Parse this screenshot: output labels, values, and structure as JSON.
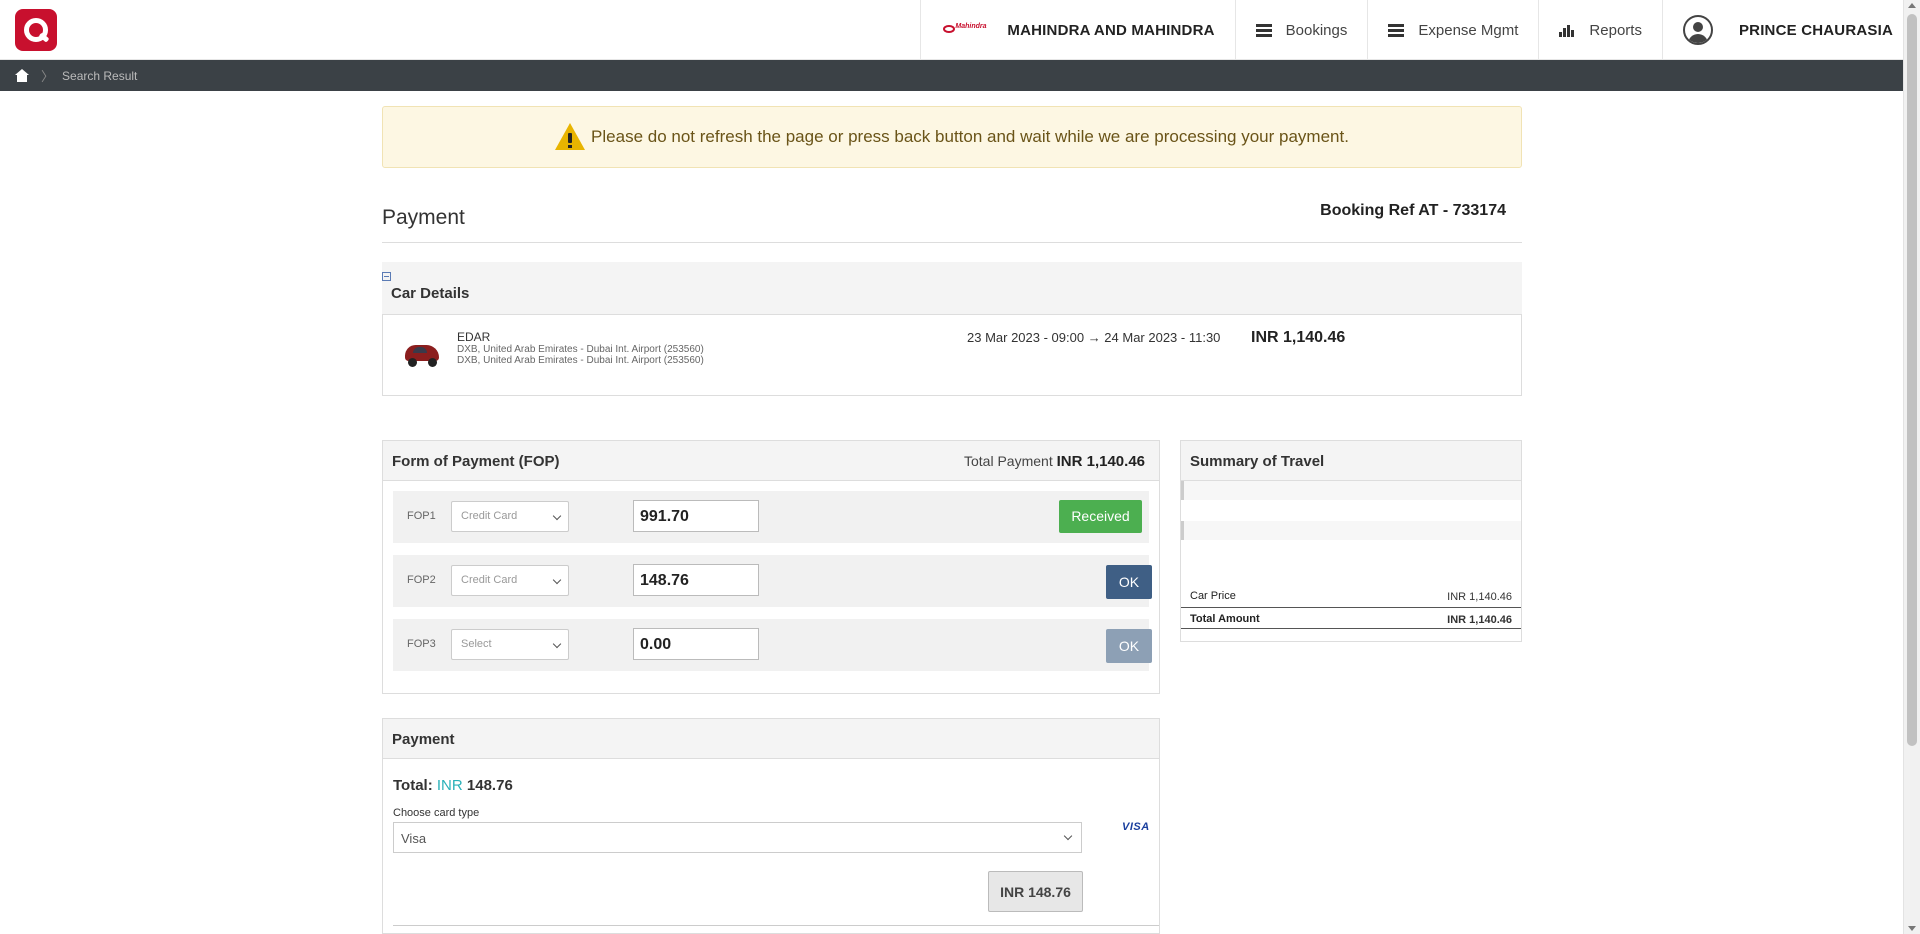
{
  "header": {
    "brand_mini_word": "Mahindra",
    "company": "MAHINDRA AND MAHINDRA",
    "nav": {
      "bookings": "Bookings",
      "expense": "Expense Mgmt",
      "reports": "Reports"
    },
    "user": "PRINCE CHAURASIA"
  },
  "breadcrumb": {
    "separator": "〉",
    "current": "Search Result"
  },
  "warning": {
    "text": "Please do not refresh the page or press back button and wait while we are processing your payment."
  },
  "page": {
    "title": "Payment",
    "booking_ref": "Booking Ref AT - 733174"
  },
  "car": {
    "section_title": "Car Details",
    "name": "EDAR",
    "pickup_location": "DXB, United Arab Emirates - Dubai Int. Airport (253560)",
    "dropoff_location": "DXB, United Arab Emirates - Dubai Int. Airport (253560)",
    "dates": "23 Mar 2023 - 09:00 → 24 Mar 2023 - 11:30",
    "price": "INR 1,140.46"
  },
  "fop": {
    "title": "Form of Payment (FOP)",
    "total_label": "Total Payment",
    "total_value": "INR 1,140.46",
    "rows": [
      {
        "label": "FOP1",
        "method": "Credit Card",
        "amount": "991.70",
        "action": "Received"
      },
      {
        "label": "FOP2",
        "method": "Credit Card",
        "amount": "148.76",
        "action": "OK"
      },
      {
        "label": "FOP3",
        "method": "Select",
        "amount": "0.00",
        "action": "OK"
      }
    ]
  },
  "summary": {
    "title": "Summary of Travel",
    "car_price_label": "Car Price",
    "car_price_value": "INR 1,140.46",
    "total_label": "Total Amount",
    "total_value": "INR 1,140.46"
  },
  "payment": {
    "title": "Payment",
    "total_label": "Total:",
    "total_currency": "INR",
    "total_amount": "148.76",
    "card_type_label": "Choose card type",
    "card_type_value": "Visa",
    "card_logo": "VISA",
    "pay_button": "INR 148.76"
  },
  "colors": {
    "brand_red": "#c8102e",
    "received_green": "#4caf50",
    "ok_blue": "#3f5f85",
    "currency_teal": "#2ab1b9",
    "breadcrumb_bg": "#3b4146"
  }
}
